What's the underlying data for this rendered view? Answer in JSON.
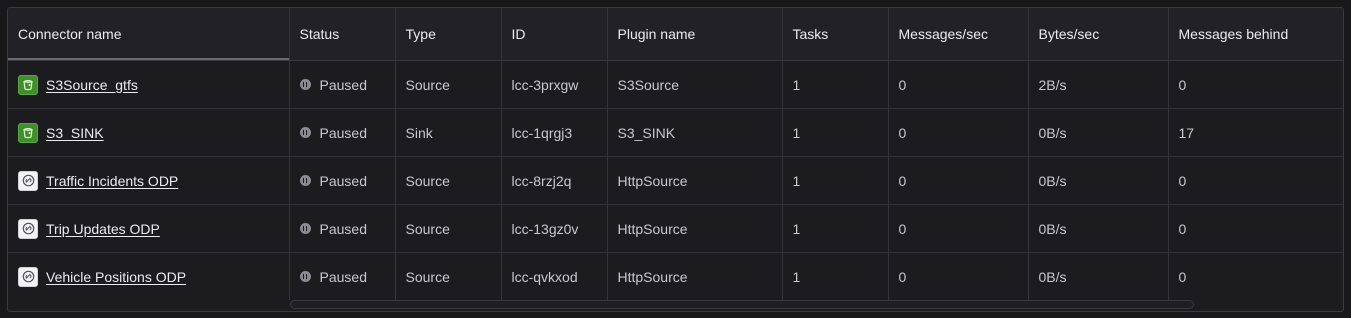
{
  "columns": [
    "Connector name",
    "Status",
    "Type",
    "ID",
    "Plugin name",
    "Tasks",
    "Messages/sec",
    "Bytes/sec",
    "Messages behind"
  ],
  "rows": [
    {
      "name": "S3Source_gtfs",
      "icon": "s3-bucket-icon",
      "status": "Paused",
      "type": "Source",
      "id": "lcc-3prxgw",
      "plugin": "S3Source",
      "tasks": "1",
      "msgs": "0",
      "bytes": "2B/s",
      "behind": "0"
    },
    {
      "name": "S3_SINK",
      "icon": "s3-bucket-icon",
      "status": "Paused",
      "type": "Sink",
      "id": "lcc-1qrgj3",
      "plugin": "S3_SINK",
      "tasks": "1",
      "msgs": "0",
      "bytes": "0B/s",
      "behind": "17"
    },
    {
      "name": "Traffic Incidents ODP",
      "icon": "http-connector-icon",
      "status": "Paused",
      "type": "Source",
      "id": "lcc-8rzj2q",
      "plugin": "HttpSource",
      "tasks": "1",
      "msgs": "0",
      "bytes": "0B/s",
      "behind": "0"
    },
    {
      "name": "Trip Updates ODP",
      "icon": "http-connector-icon",
      "status": "Paused",
      "type": "Source",
      "id": "lcc-13gz0v",
      "plugin": "HttpSource",
      "tasks": "1",
      "msgs": "0",
      "bytes": "0B/s",
      "behind": "0"
    },
    {
      "name": "Vehicle Positions ODP",
      "icon": "http-connector-icon",
      "status": "Paused",
      "type": "Source",
      "id": "lcc-qvkxod",
      "plugin": "HttpSource",
      "tasks": "1",
      "msgs": "0",
      "bytes": "0B/s",
      "behind": "0"
    }
  ],
  "colors": {
    "s3_icon_bg": "#3f8f2a",
    "http_icon_bg": "#f4f4f5",
    "paused_icon": "#8a8a92"
  }
}
